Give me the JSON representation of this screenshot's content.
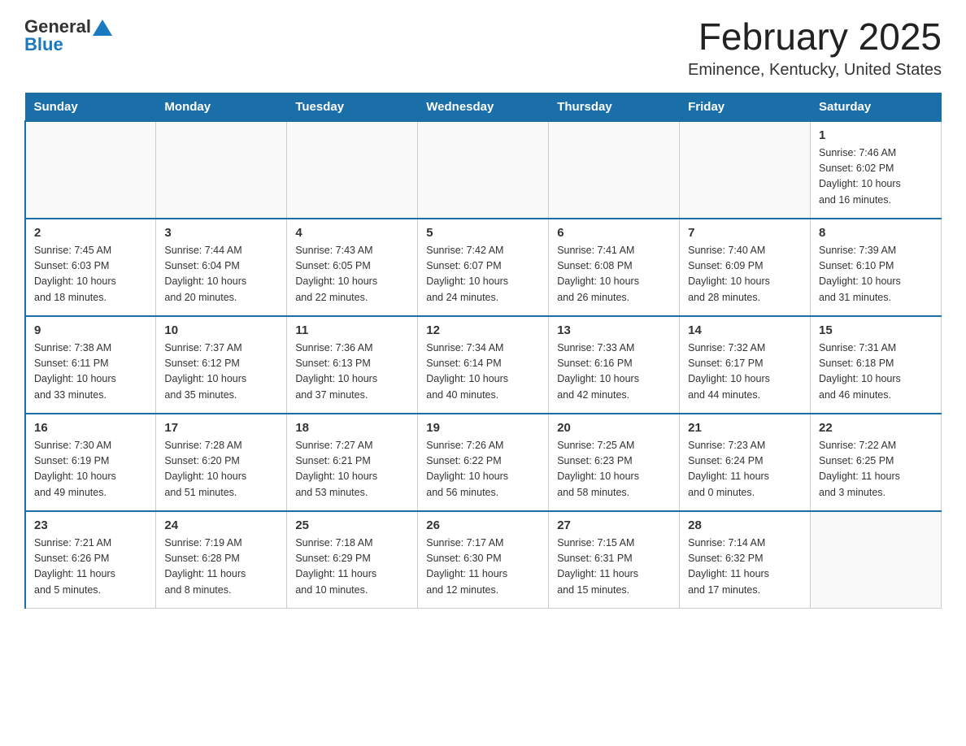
{
  "header": {
    "logo_general": "General",
    "logo_blue": "Blue",
    "month_title": "February 2025",
    "location": "Eminence, Kentucky, United States"
  },
  "days_of_week": [
    "Sunday",
    "Monday",
    "Tuesday",
    "Wednesday",
    "Thursday",
    "Friday",
    "Saturday"
  ],
  "weeks": [
    [
      {
        "day": "",
        "info": ""
      },
      {
        "day": "",
        "info": ""
      },
      {
        "day": "",
        "info": ""
      },
      {
        "day": "",
        "info": ""
      },
      {
        "day": "",
        "info": ""
      },
      {
        "day": "",
        "info": ""
      },
      {
        "day": "1",
        "info": "Sunrise: 7:46 AM\nSunset: 6:02 PM\nDaylight: 10 hours\nand 16 minutes."
      }
    ],
    [
      {
        "day": "2",
        "info": "Sunrise: 7:45 AM\nSunset: 6:03 PM\nDaylight: 10 hours\nand 18 minutes."
      },
      {
        "day": "3",
        "info": "Sunrise: 7:44 AM\nSunset: 6:04 PM\nDaylight: 10 hours\nand 20 minutes."
      },
      {
        "day": "4",
        "info": "Sunrise: 7:43 AM\nSunset: 6:05 PM\nDaylight: 10 hours\nand 22 minutes."
      },
      {
        "day": "5",
        "info": "Sunrise: 7:42 AM\nSunset: 6:07 PM\nDaylight: 10 hours\nand 24 minutes."
      },
      {
        "day": "6",
        "info": "Sunrise: 7:41 AM\nSunset: 6:08 PM\nDaylight: 10 hours\nand 26 minutes."
      },
      {
        "day": "7",
        "info": "Sunrise: 7:40 AM\nSunset: 6:09 PM\nDaylight: 10 hours\nand 28 minutes."
      },
      {
        "day": "8",
        "info": "Sunrise: 7:39 AM\nSunset: 6:10 PM\nDaylight: 10 hours\nand 31 minutes."
      }
    ],
    [
      {
        "day": "9",
        "info": "Sunrise: 7:38 AM\nSunset: 6:11 PM\nDaylight: 10 hours\nand 33 minutes."
      },
      {
        "day": "10",
        "info": "Sunrise: 7:37 AM\nSunset: 6:12 PM\nDaylight: 10 hours\nand 35 minutes."
      },
      {
        "day": "11",
        "info": "Sunrise: 7:36 AM\nSunset: 6:13 PM\nDaylight: 10 hours\nand 37 minutes."
      },
      {
        "day": "12",
        "info": "Sunrise: 7:34 AM\nSunset: 6:14 PM\nDaylight: 10 hours\nand 40 minutes."
      },
      {
        "day": "13",
        "info": "Sunrise: 7:33 AM\nSunset: 6:16 PM\nDaylight: 10 hours\nand 42 minutes."
      },
      {
        "day": "14",
        "info": "Sunrise: 7:32 AM\nSunset: 6:17 PM\nDaylight: 10 hours\nand 44 minutes."
      },
      {
        "day": "15",
        "info": "Sunrise: 7:31 AM\nSunset: 6:18 PM\nDaylight: 10 hours\nand 46 minutes."
      }
    ],
    [
      {
        "day": "16",
        "info": "Sunrise: 7:30 AM\nSunset: 6:19 PM\nDaylight: 10 hours\nand 49 minutes."
      },
      {
        "day": "17",
        "info": "Sunrise: 7:28 AM\nSunset: 6:20 PM\nDaylight: 10 hours\nand 51 minutes."
      },
      {
        "day": "18",
        "info": "Sunrise: 7:27 AM\nSunset: 6:21 PM\nDaylight: 10 hours\nand 53 minutes."
      },
      {
        "day": "19",
        "info": "Sunrise: 7:26 AM\nSunset: 6:22 PM\nDaylight: 10 hours\nand 56 minutes."
      },
      {
        "day": "20",
        "info": "Sunrise: 7:25 AM\nSunset: 6:23 PM\nDaylight: 10 hours\nand 58 minutes."
      },
      {
        "day": "21",
        "info": "Sunrise: 7:23 AM\nSunset: 6:24 PM\nDaylight: 11 hours\nand 0 minutes."
      },
      {
        "day": "22",
        "info": "Sunrise: 7:22 AM\nSunset: 6:25 PM\nDaylight: 11 hours\nand 3 minutes."
      }
    ],
    [
      {
        "day": "23",
        "info": "Sunrise: 7:21 AM\nSunset: 6:26 PM\nDaylight: 11 hours\nand 5 minutes."
      },
      {
        "day": "24",
        "info": "Sunrise: 7:19 AM\nSunset: 6:28 PM\nDaylight: 11 hours\nand 8 minutes."
      },
      {
        "day": "25",
        "info": "Sunrise: 7:18 AM\nSunset: 6:29 PM\nDaylight: 11 hours\nand 10 minutes."
      },
      {
        "day": "26",
        "info": "Sunrise: 7:17 AM\nSunset: 6:30 PM\nDaylight: 11 hours\nand 12 minutes."
      },
      {
        "day": "27",
        "info": "Sunrise: 7:15 AM\nSunset: 6:31 PM\nDaylight: 11 hours\nand 15 minutes."
      },
      {
        "day": "28",
        "info": "Sunrise: 7:14 AM\nSunset: 6:32 PM\nDaylight: 11 hours\nand 17 minutes."
      },
      {
        "day": "",
        "info": ""
      }
    ]
  ]
}
